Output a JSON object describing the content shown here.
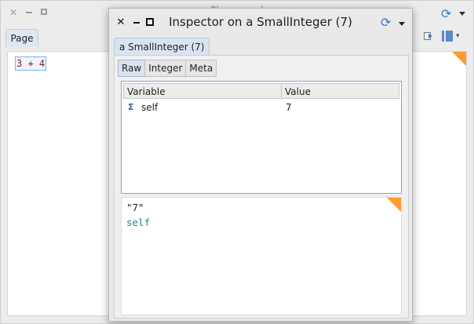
{
  "playground": {
    "title": "Playground",
    "page_tab": "Page",
    "code": "3 + 4",
    "colors": {
      "refresh": "#3a79c8",
      "corner": "#ff9a2e"
    }
  },
  "inspector": {
    "title": "Inspector on a SmallInteger (7)",
    "page_tab": "a SmallInteger (7)",
    "tabs": [
      "Raw",
      "Integer",
      "Meta"
    ],
    "active_tab": "Raw",
    "table": {
      "columns": [
        "Variable",
        "Value"
      ],
      "rows": [
        {
          "icon": "Σ",
          "variable": "self",
          "value": "7"
        }
      ]
    },
    "evaluator": {
      "line1": "\"7\"",
      "line2": "self"
    }
  }
}
